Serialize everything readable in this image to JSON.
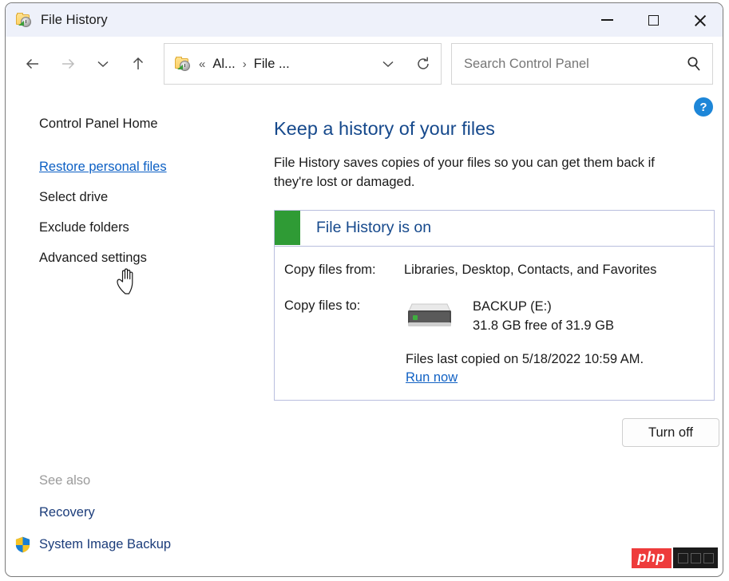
{
  "window": {
    "title": "File History",
    "icon": "folder-history-icon",
    "controls": {
      "minimize": "minimize-icon",
      "maximize": "maximize-icon",
      "close": "close-icon"
    }
  },
  "toolbar": {
    "back": "back-arrow-icon",
    "forward": "forward-arrow-icon",
    "recent": "chevron-down-icon",
    "up": "up-arrow-icon",
    "breadcrumb": {
      "icon": "folder-history-icon",
      "chevrons": "«",
      "parent": "Al...",
      "separator": "›",
      "current": "File ...",
      "dropdown": "chevron-down-icon",
      "refresh": "refresh-icon"
    },
    "search": {
      "placeholder": "Search Control Panel",
      "value": "",
      "icon": "search-icon"
    }
  },
  "sidebar": {
    "items": [
      {
        "label": "Control Panel Home",
        "state": "plain"
      },
      {
        "label": "Restore personal files",
        "state": "hovered"
      },
      {
        "label": "Select drive",
        "state": "plain"
      },
      {
        "label": "Exclude folders",
        "state": "plain"
      },
      {
        "label": "Advanced settings",
        "state": "plain"
      }
    ],
    "see_also": {
      "title": "See also",
      "items": [
        {
          "label": "Recovery",
          "icon": null
        },
        {
          "label": "System Image Backup",
          "icon": "uac-shield-icon"
        }
      ]
    }
  },
  "main": {
    "help": "?",
    "heading": "Keep a history of your files",
    "description": "File History saves copies of your files so you can get them back if they're lost or damaged.",
    "status": {
      "indicator_color": "#2f9b35",
      "label": "File History is on"
    },
    "copy_from": {
      "label": "Copy files from:",
      "value": "Libraries, Desktop, Contacts, and Favorites"
    },
    "copy_to": {
      "label": "Copy files to:",
      "drive_icon": "external-drive-icon",
      "drive_name": "BACKUP (E:)",
      "drive_capacity": "31.8 GB free of 31.9 GB",
      "last_copied": "Files last copied on 5/18/2022 10:59 AM.",
      "run_now": "Run now"
    },
    "turn_off_button": "Turn off"
  },
  "watermark": {
    "text": "php"
  },
  "colors": {
    "heading_blue": "#16498c",
    "link_blue": "#1262c4",
    "status_green": "#2f9b35",
    "panel_border": "#b9bede",
    "titlebar_bg": "#eef1fa"
  }
}
